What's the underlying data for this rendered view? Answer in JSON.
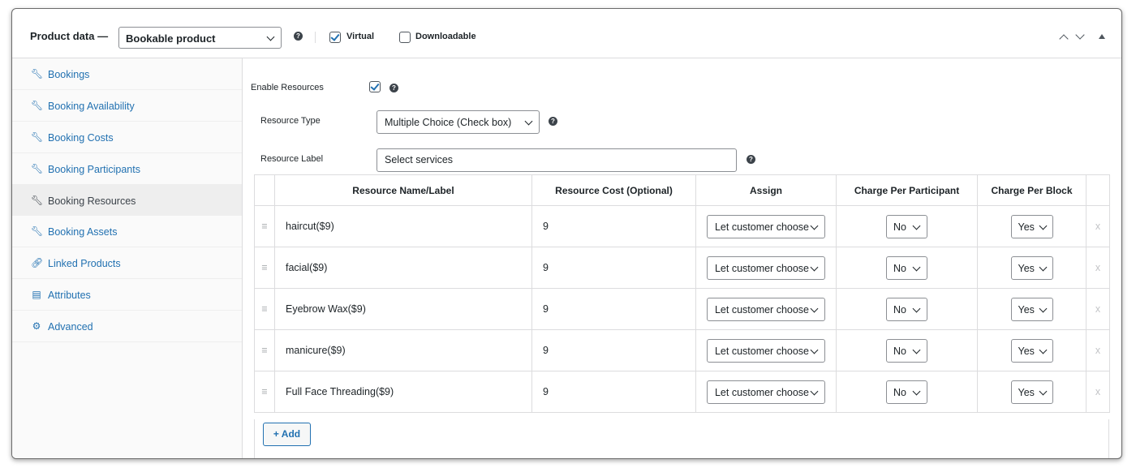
{
  "header": {
    "title": "Product data —",
    "product_type": "Bookable product",
    "virtual_label": "Virtual",
    "virtual_checked": true,
    "downloadable_label": "Downloadable",
    "downloadable_checked": false
  },
  "sidebar": {
    "items": [
      {
        "label": "Bookings",
        "icon": "wrench-icon",
        "active": false
      },
      {
        "label": "Booking Availability",
        "icon": "wrench-icon",
        "active": false
      },
      {
        "label": "Booking Costs",
        "icon": "wrench-icon",
        "active": false
      },
      {
        "label": "Booking Participants",
        "icon": "wrench-icon",
        "active": false
      },
      {
        "label": "Booking Resources",
        "icon": "wrench-icon",
        "active": true
      },
      {
        "label": "Booking Assets",
        "icon": "wrench-icon",
        "active": false
      },
      {
        "label": "Linked Products",
        "icon": "link-icon",
        "active": false
      },
      {
        "label": "Attributes",
        "icon": "list-icon",
        "active": false
      },
      {
        "label": "Advanced",
        "icon": "gear-icon",
        "active": false
      }
    ]
  },
  "fields": {
    "enable_resources_label": "Enable Resources",
    "enable_resources_checked": true,
    "resource_type_label": "Resource Type",
    "resource_type_value": "Multiple Choice (Check box)",
    "resource_label_label": "Resource Label",
    "resource_label_value": "Select services"
  },
  "table": {
    "headers": [
      "Resource Name/Label",
      "Resource Cost (Optional)",
      "Assign",
      "Charge Per Participant",
      "Charge Per Block"
    ],
    "rows": [
      {
        "name": "haircut($9)",
        "cost": "9",
        "assign": "Let customer choose",
        "per_participant": "No",
        "per_block": "Yes",
        "remove": "x"
      },
      {
        "name": "facial($9)",
        "cost": "9",
        "assign": "Let customer choose",
        "per_participant": "No",
        "per_block": "Yes",
        "remove": "x"
      },
      {
        "name": "Eyebrow Wax($9)",
        "cost": "9",
        "assign": "Let customer choose",
        "per_participant": "No",
        "per_block": "Yes",
        "remove": "x"
      },
      {
        "name": "manicure($9)",
        "cost": "9",
        "assign": "Let customer choose",
        "per_participant": "No",
        "per_block": "Yes",
        "remove": "x"
      },
      {
        "name": "Full Face Threading($9)",
        "cost": "9",
        "assign": "Let customer choose",
        "per_participant": "No",
        "per_block": "Yes",
        "remove": "x"
      }
    ],
    "add_label": "+ Add"
  },
  "colors": {
    "accent": "#2271b1",
    "border": "#dcdcde",
    "active_tab_bg": "#eeeeee"
  }
}
